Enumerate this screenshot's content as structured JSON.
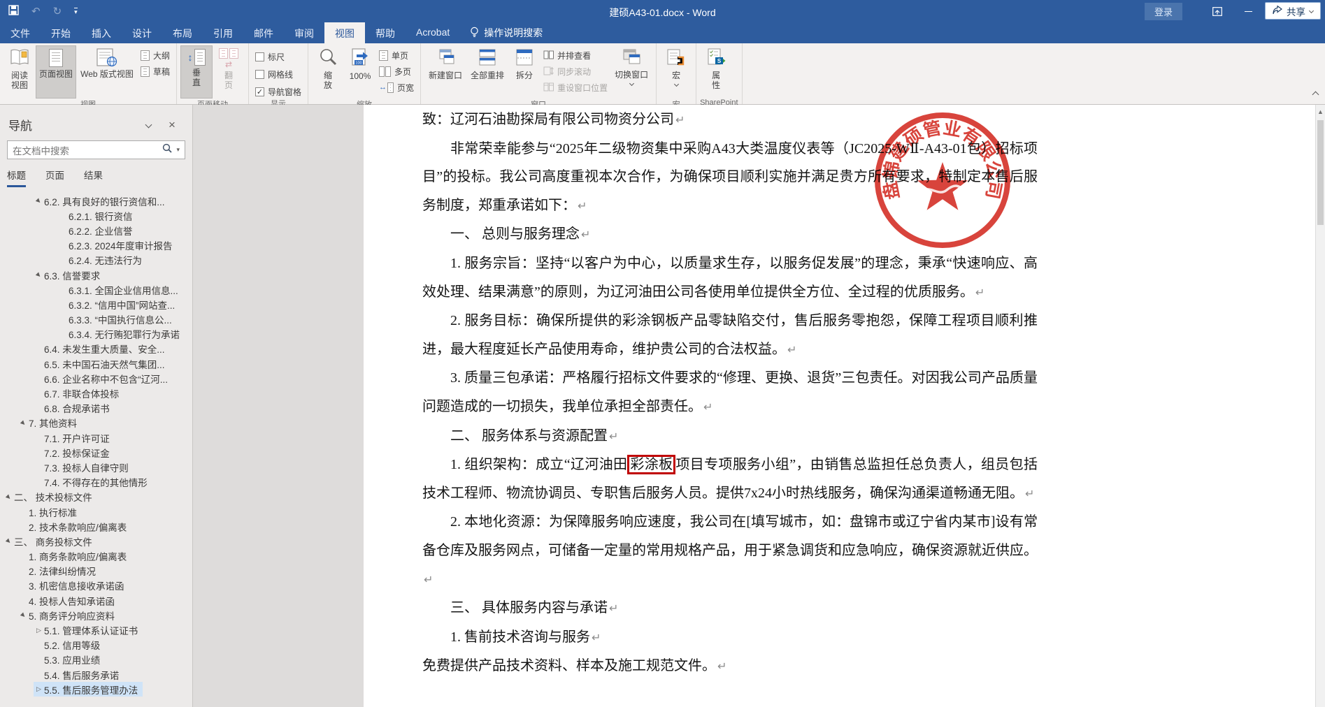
{
  "titlebar": {
    "title": "建硕A43-01.docx - Word",
    "signin_label": "登录"
  },
  "tabs": {
    "items": [
      "文件",
      "开始",
      "插入",
      "设计",
      "布局",
      "引用",
      "邮件",
      "审阅",
      "视图",
      "帮助",
      "Acrobat"
    ],
    "active": "视图",
    "tellme": "操作说明搜索",
    "share_label": "共享"
  },
  "ribbon": {
    "group_view": {
      "label": "视图",
      "read_view": "阅读视图",
      "print_view": "页面视图",
      "web_view": "Web 版式视图",
      "outline": "大纲",
      "draft": "草稿"
    },
    "group_page_move": {
      "label": "页面移动",
      "vertical": "垂直",
      "side_to_side": "翻页"
    },
    "group_show": {
      "label": "显示",
      "ruler": "标尺",
      "gridlines": "网格线",
      "nav_pane": "导航窗格"
    },
    "group_zoom": {
      "label": "缩放",
      "zoom": "缩放",
      "pct": "100%",
      "one_page": "单页",
      "multi_page": "多页",
      "page_width": "页宽"
    },
    "group_window": {
      "label": "窗口",
      "new_window": "新建窗口",
      "arrange_all": "全部重排",
      "split": "拆分",
      "view_side": "并排查看",
      "sync_scroll": "同步滚动",
      "reset_pos": "重设窗口位置",
      "switch_win": "切换窗口"
    },
    "group_macros": {
      "label": "宏",
      "macros": "宏"
    },
    "group_sharepoint": {
      "label": "SharePoint",
      "properties": "属性"
    }
  },
  "nav": {
    "title": "导航",
    "search_placeholder": "在文档中搜索",
    "tabs": [
      "标题",
      "页面",
      "结果"
    ],
    "active_tab": "标题",
    "items": [
      {
        "lvl": 3,
        "state": "exp",
        "label": "6.2. 具有良好的银行资信和..."
      },
      {
        "lvl": 4,
        "state": "",
        "label": "6.2.1. 银行资信"
      },
      {
        "lvl": 4,
        "state": "",
        "label": "6.2.2. 企业信誉"
      },
      {
        "lvl": 4,
        "state": "",
        "label": "6.2.3. 2024年度审计报告"
      },
      {
        "lvl": 4,
        "state": "",
        "label": "6.2.4. 无违法行为"
      },
      {
        "lvl": 3,
        "state": "exp",
        "label": "6.3. 信誉要求"
      },
      {
        "lvl": 4,
        "state": "",
        "label": "6.3.1. 全国企业信用信息..."
      },
      {
        "lvl": 4,
        "state": "",
        "label": "6.3.2. “信用中国”网站查..."
      },
      {
        "lvl": 4,
        "state": "",
        "label": "6.3.3. “中国执行信息公..."
      },
      {
        "lvl": 4,
        "state": "",
        "label": "6.3.4. 无行贿犯罪行为承诺"
      },
      {
        "lvl": 3,
        "state": "",
        "label": "6.4. 未发生重大质量、安全..."
      },
      {
        "lvl": 3,
        "state": "",
        "label": "6.5. 未中国石油天然气集团..."
      },
      {
        "lvl": 3,
        "state": "",
        "label": "6.6. 企业名称中不包含“辽河..."
      },
      {
        "lvl": 3,
        "state": "",
        "label": "6.7. 非联合体投标"
      },
      {
        "lvl": 3,
        "state": "",
        "label": "6.8. 合规承诺书"
      },
      {
        "lvl": 2,
        "state": "exp",
        "label": "7. 其他资料"
      },
      {
        "lvl": 3,
        "state": "",
        "label": "7.1. 开户许可证"
      },
      {
        "lvl": 3,
        "state": "",
        "label": "7.2. 投标保证金"
      },
      {
        "lvl": 3,
        "state": "",
        "label": "7.3. 投标人自律守则"
      },
      {
        "lvl": 3,
        "state": "",
        "label": "7.4. 不得存在的其他情形"
      },
      {
        "lvl": 1,
        "state": "exp",
        "label": "二、 技术投标文件"
      },
      {
        "lvl": 2,
        "state": "",
        "label": "1. 执行标准"
      },
      {
        "lvl": 2,
        "state": "",
        "label": "2. 技术条款响应/偏离表"
      },
      {
        "lvl": 1,
        "state": "exp",
        "label": "三、 商务投标文件"
      },
      {
        "lvl": 2,
        "state": "",
        "label": "1. 商务条款响应/偏离表"
      },
      {
        "lvl": 2,
        "state": "",
        "label": "2. 法律纠纷情况"
      },
      {
        "lvl": 2,
        "state": "",
        "label": "3. 机密信息接收承诺函"
      },
      {
        "lvl": 2,
        "state": "",
        "label": "4. 投标人告知承诺函"
      },
      {
        "lvl": 2,
        "state": "exp",
        "label": "5. 商务评分响应资料"
      },
      {
        "lvl": 3,
        "state": "col",
        "label": "5.1. 管理体系认证证书"
      },
      {
        "lvl": 3,
        "state": "",
        "label": "5.2. 信用等级"
      },
      {
        "lvl": 3,
        "state": "",
        "label": "5.3. 应用业绩"
      },
      {
        "lvl": 3,
        "state": "",
        "label": "5.4. 售后服务承诺"
      },
      {
        "lvl": 3,
        "state": "col",
        "label": "5.5. 售后服务管理办法",
        "selected": true
      }
    ]
  },
  "document": {
    "paragraphs": [
      {
        "indent": false,
        "runs": [
          {
            "t": "致：辽河石油勘探局有限公司物资分公司"
          }
        ]
      },
      {
        "indent": true,
        "runs": [
          {
            "t": "非常荣幸能参与“2025年二级物资集中采购A43大类温度仪表等（JC2025-WⅡ-A43-01包）招标项目”的投标。我公司高度重视本次合作，为确保项目顺利实施并满足贵方所有要求，特制定本售后服务制度，郑重承诺如下："
          }
        ]
      },
      {
        "indent": true,
        "runs": [
          {
            "t": "一、 总则与服务理念"
          }
        ]
      },
      {
        "indent": true,
        "runs": [
          {
            "t": "1. 服务宗旨：坚持“以客户为中心，以质量求生存，以服务促发展”的理念，秉承“快速响应、高效处理、结果满意”的原则，为辽河油田公司各使用单位提供全方位、全过程的优质服务。"
          }
        ]
      },
      {
        "indent": true,
        "runs": [
          {
            "t": "2. 服务目标：确保所提供的彩涂钢板产品零缺陷交付，售后服务零抱怨，保障工程项目顺利推进，最大程度延长产品使用寿命，维护贵公司的合法权益。"
          }
        ]
      },
      {
        "indent": true,
        "runs": [
          {
            "t": "3. 质量三包承诺：严格履行招标文件要求的“修理、更换、退货”三包责任。对因我公司产品质量问题造成的一切损失，我单位承担全部责任。"
          }
        ]
      },
      {
        "indent": true,
        "runs": [
          {
            "t": "二、 服务体系与资源配置"
          }
        ]
      },
      {
        "indent": true,
        "runs": [
          {
            "t": "1. 组织架构：成立“辽河油田"
          },
          {
            "t": "彩涂板",
            "box": true
          },
          {
            "t": "项目专项服务小组”，由销售总监担任总负责人，组员包括技术工程师、物流协调员、专职售后服务人员。提供7x24小时热线服务，确保沟通渠道畅通无阻。"
          }
        ]
      },
      {
        "indent": true,
        "runs": [
          {
            "t": "2. 本地化资源：为保障服务响应速度，我公司在[填写城市，如：盘锦市或辽宁省内某市]设有常备仓库及服务网点，可储备一定量的常用规格产品，用于紧急调货和应急响应，确保资源就近供应。"
          }
        ]
      },
      {
        "indent": true,
        "runs": [
          {
            "t": "三、 具体服务内容与承诺"
          }
        ]
      },
      {
        "indent": true,
        "runs": [
          {
            "t": "1. 售前技术咨询与服务"
          }
        ]
      },
      {
        "indent": false,
        "runs": [
          {
            "t": "免费提供产品技术资料、样本及施工规范文件。"
          }
        ]
      }
    ]
  },
  "stamp": {
    "company": "盘锦建硕管业有限公司"
  },
  "colors": {
    "chrome_blue": "#2e5c9e",
    "accent_blue": "#2b579a",
    "stamp_red": "#d3281e",
    "highlight_box_red": "#c00000",
    "nav_selected": "#cfe3f7"
  }
}
